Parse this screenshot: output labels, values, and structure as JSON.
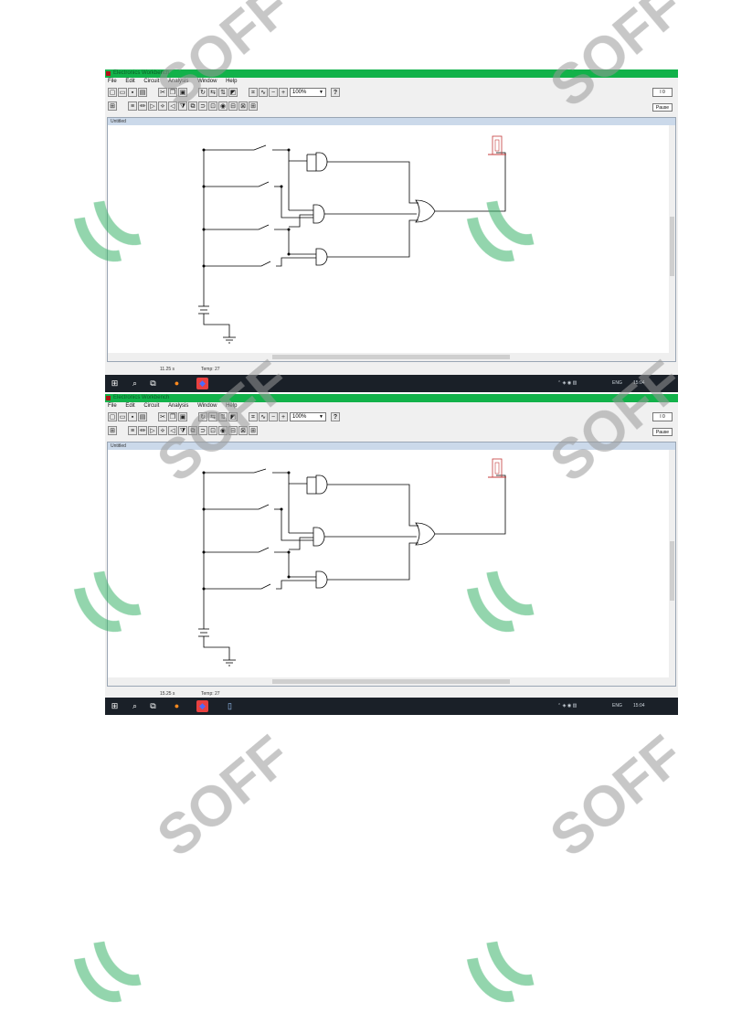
{
  "screenshots": [
    {
      "title": "Electronics Workbench",
      "menu": [
        "File",
        "Edit",
        "Circuit",
        "Analysis",
        "Window",
        "Help"
      ],
      "zoom": "100%",
      "pause_label": "Pause",
      "doc_title": "Untitled",
      "status_left": "11.25 s",
      "status_mid": "Temp: 27",
      "tray_lang": "ENG",
      "tray_time": "15:04"
    },
    {
      "title": "Electronics Workbench",
      "menu": [
        "File",
        "Edit",
        "Circuit",
        "Analysis",
        "Window",
        "Help"
      ],
      "zoom": "100%",
      "pause_label": "Pause",
      "doc_title": "Untitled",
      "status_left": "15.25 s",
      "status_mid": "Temp: 27",
      "tray_lang": "ENG",
      "tray_time": "15:04"
    }
  ],
  "watermark": {
    "text": "SOFF",
    "color": "#9a9a9a",
    "logo_color": "#3bb36a"
  },
  "probe_color": "#c43a3a"
}
